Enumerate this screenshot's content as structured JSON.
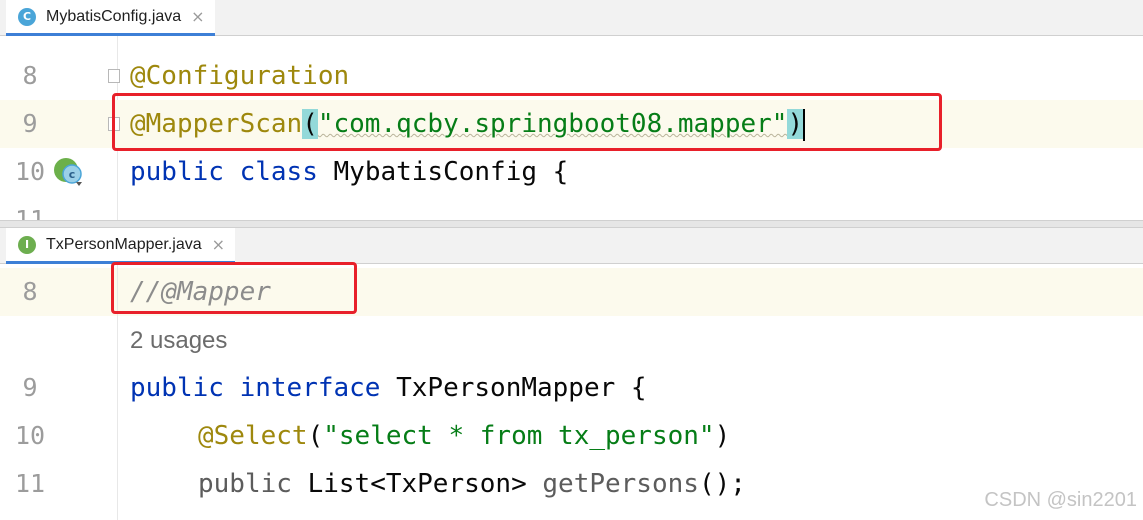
{
  "top_editor": {
    "tab": {
      "icon_letter": "C",
      "icon_color": "#4aa5d8",
      "label": "MybatisConfig.java",
      "close": "×"
    },
    "lines": [
      {
        "number": "8",
        "code": "@Configuration"
      },
      {
        "number": "9",
        "annotation": "@MapperScan",
        "open_paren": "(",
        "string": "\"com.qcby.springboot08.mapper\"",
        "close_paren": ")"
      },
      {
        "number": "10",
        "kw1": "public",
        "kw2": "class",
        "name": "MybatisConfig {"
      },
      {
        "number": "11"
      }
    ]
  },
  "bottom_editor": {
    "tab": {
      "icon_letter": "I",
      "icon_color": "#6dae4f",
      "label": "TxPersonMapper.java",
      "close": "×"
    },
    "lines": [
      {
        "number": "8",
        "comment": "//@Mapper"
      },
      {
        "usages": "2 usages"
      },
      {
        "number": "9",
        "kw1": "public",
        "kw2": "interface",
        "name": "TxPersonMapper {"
      },
      {
        "number": "10",
        "annotation": "@Select",
        "open_paren": "(",
        "string": "\"select * from tx_person\"",
        "close_paren": ")"
      },
      {
        "number": "11",
        "kw": "public",
        "type": "List<TxPerson>",
        "method": "getPersons",
        "tail": "();"
      }
    ]
  },
  "watermark": "CSDN @sin2201",
  "colors": {
    "highlight_box": "#e8202a",
    "keyword": "#0033b3",
    "string": "#067d17",
    "annotation": "#9e880d"
  }
}
